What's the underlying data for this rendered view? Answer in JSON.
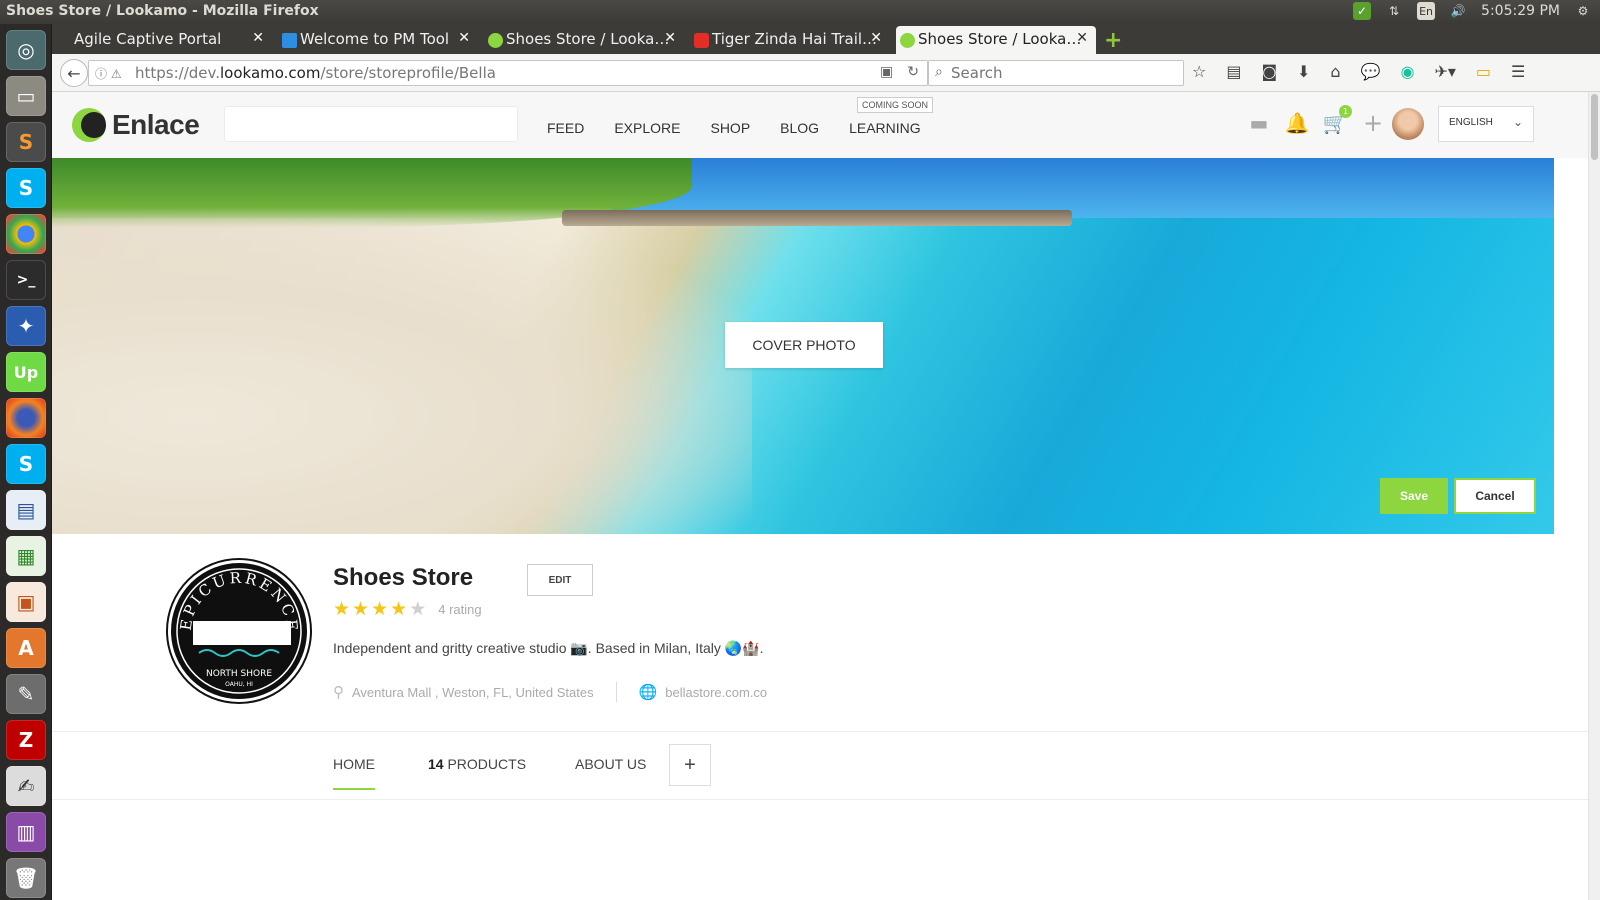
{
  "window": {
    "title": "Shoes Store / Lookamo - Mozilla Firefox"
  },
  "tray": {
    "lang": "En",
    "time": "5:05:29 PM"
  },
  "tabs": [
    {
      "label": "Agile Captive Portal",
      "fav_color": ""
    },
    {
      "label": "Welcome to PM Tool",
      "fav_color": "#2d8ee2"
    },
    {
      "label": "Shoes Store / Looka…",
      "fav_color": "#8dd63f"
    },
    {
      "label": "Tiger Zinda Hai Trail…",
      "fav_color": "#e52d27"
    },
    {
      "label": "Shoes Store / Looka…",
      "fav_color": "#8dd63f"
    }
  ],
  "addressbar": {
    "url_prefix": "https://dev.",
    "url_domain": "lookamo.com",
    "url_path": "/store/storeprofile/Bella"
  },
  "searchbar": {
    "placeholder": "Search"
  },
  "site": {
    "brand": "Enlace",
    "nav": [
      "FEED",
      "EXPLORE",
      "SHOP",
      "BLOG",
      "LEARNING"
    ],
    "coming_soon": "COMING SOON",
    "cart_count": "1",
    "language": "ENGLISH"
  },
  "cover": {
    "button": "COVER PHOTO",
    "save": "Save",
    "cancel": "Cancel"
  },
  "store": {
    "name": "Shoes Store",
    "edit": "EDIT",
    "rating": 4,
    "rating_max": 5,
    "rating_label": "4 rating",
    "bio": "Independent and gritty creative studio 📷. Based in Milan, Italy 🌏🏰.",
    "location": "Aventura Mall , Weston, FL, United States",
    "website": "bellastore.com.co",
    "logo_text_top": "EPICURRENCE",
    "logo_text_bottom": "NORTH SHORE",
    "logo_text_sub": "OAHU, HI"
  },
  "store_tabs": {
    "home": "HOME",
    "products_count": "14",
    "products": "PRODUCTS",
    "about": "ABOUT US",
    "add": "+"
  },
  "colors": {
    "accent": "#8dd63f"
  }
}
